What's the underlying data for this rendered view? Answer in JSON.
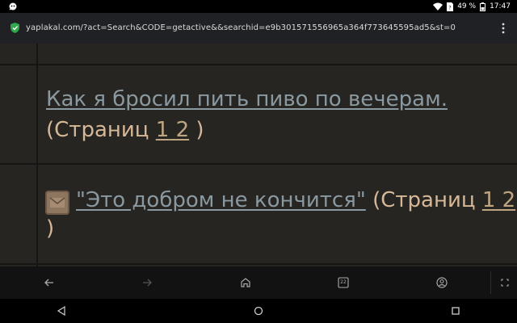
{
  "status_bar": {
    "battery_percent": "49 %",
    "time": "17:47"
  },
  "browser": {
    "url": "yaplakal.com/?act=Search&CODE=getactive&&searchid=e9b301571556965a364f773645595ad5&st=0"
  },
  "topics": [
    {
      "title": "Как я бросил пить пиво по вечерам.",
      "pages_prefix": "(Страниц ",
      "pages": [
        "1",
        "2"
      ],
      "pages_suffix": " )"
    },
    {
      "title": "\"Это добром не кончится\"",
      "pages_prefix": " (Страниц ",
      "pages": [
        "1",
        "2"
      ],
      "pages_suffix": ")"
    }
  ],
  "bottom_nav": {
    "tab_count": "22"
  },
  "colors": {
    "content_bg": "#262522",
    "link": "#8a98a0",
    "text": "#d6b896",
    "chrome_bg": "#202124"
  }
}
